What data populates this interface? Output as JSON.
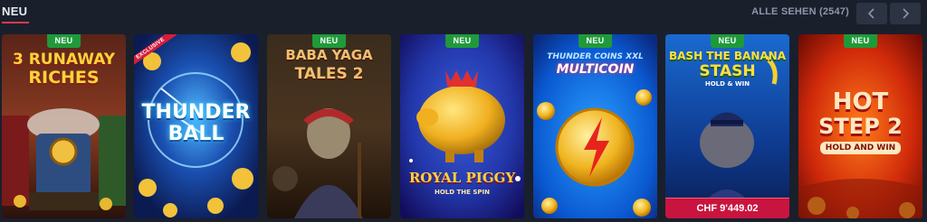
{
  "header": {
    "title": "NEU",
    "see_all": "ALLE SEHEN (2547)",
    "prev_icon": "chevron-left-icon",
    "next_icon": "chevron-right-icon"
  },
  "colors": {
    "background": "#1a1f2c",
    "accent": "#e2384d",
    "badge_green": "#1f9a3a",
    "jackpot_red": "#c8153f"
  },
  "games": [
    {
      "title_line1": "3 RUNAWAY",
      "title_line2": "RICHES",
      "badge": "NEU"
    },
    {
      "title_line1": "THUNDER",
      "title_line2": "BALL",
      "tag": "EXCLUSIVE"
    },
    {
      "title_line1": "BABA YAGA",
      "title_line2": "TALES 2",
      "badge": "NEU"
    },
    {
      "title_line1": "ROYAL PIGGY",
      "title_line2": "HOLD THE SPIN",
      "badge": "NEU"
    },
    {
      "title_line1": "THUNDER COINS XXL",
      "title_line2": "MULTICOIN",
      "badge": "NEU"
    },
    {
      "title_line1": "BASH THE BANANA",
      "title_line2": "STASH",
      "title_line3": "HOLD & WIN",
      "badge": "NEU",
      "jackpot": "CHF 9'449.02"
    },
    {
      "title_line1": "HOT",
      "title_line2": "STEP 2",
      "title_line3": "HOLD AND WIN",
      "badge": "NEU"
    }
  ]
}
